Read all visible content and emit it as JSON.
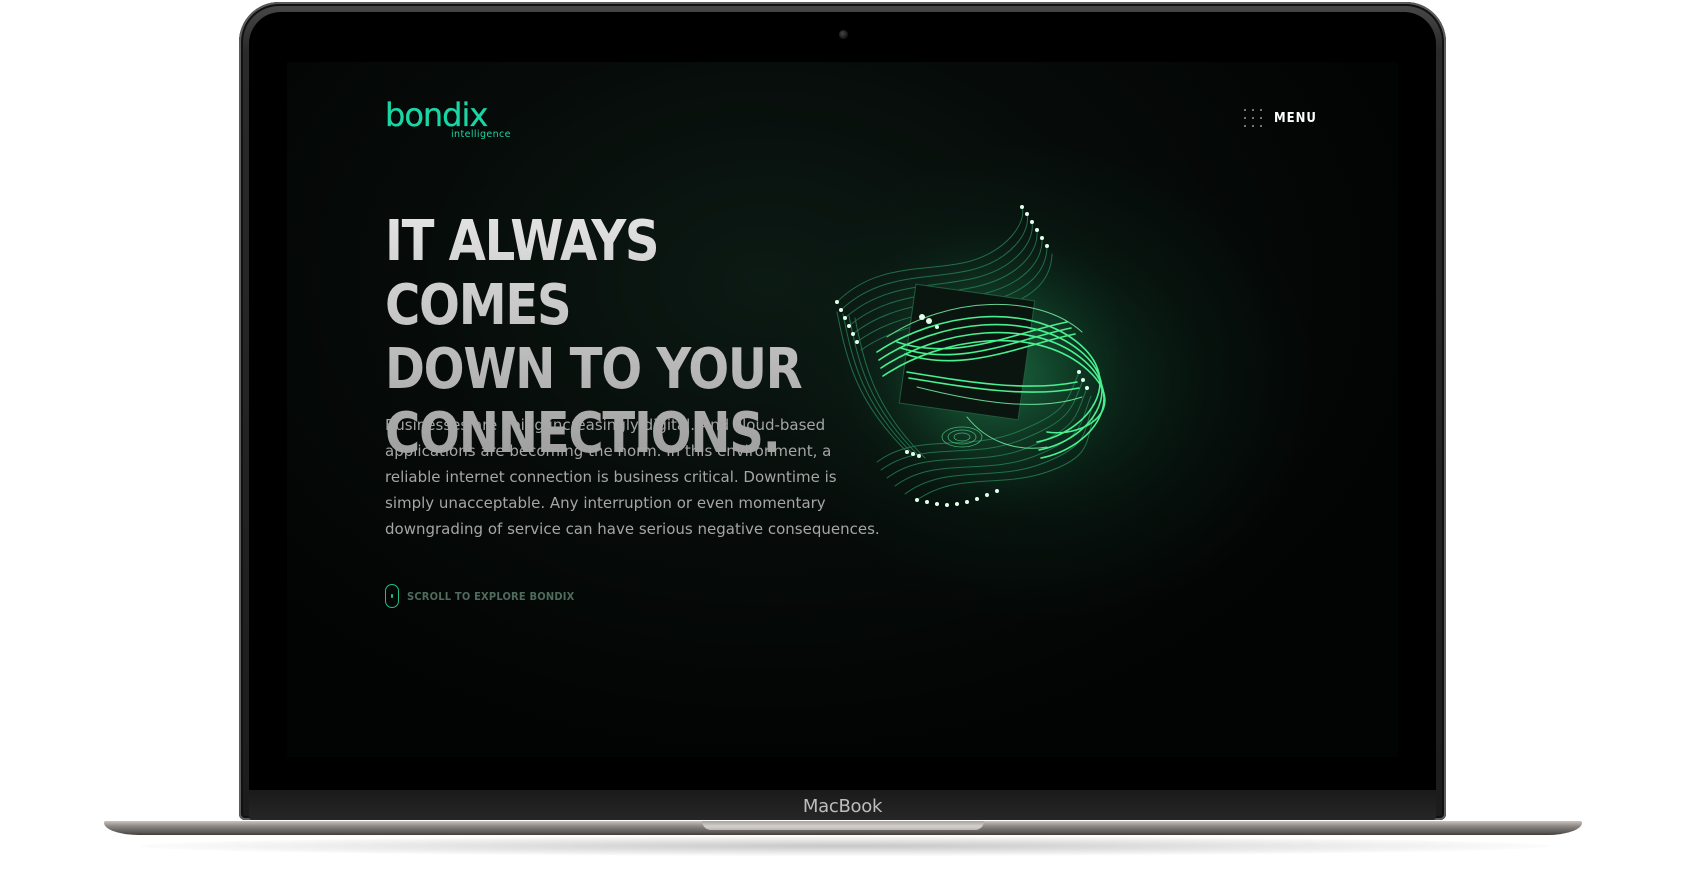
{
  "device": {
    "brand_label": "MacBook"
  },
  "site": {
    "logo": {
      "word": "bondix",
      "tagline": "intelligence"
    },
    "menu_label": "MENU",
    "hero": {
      "headline_lines": [
        "IT ALWAYS COMES",
        "DOWN TO YOUR",
        "CONNECTIONS."
      ],
      "body": "Businesses are going increasingly digital. And cloud-based applications are becoming the norm. In this environment, a reliable internet connection is business critical. Downtime is simply unacceptable. Any interruption or even momentary downgrading of service can have serious negative consequences.",
      "scroll_cta": "SCROLL TO EXPLORE BONDIX"
    }
  },
  "colors": {
    "brand": "#19d6a4",
    "accent_glow": "#2ee07d",
    "background": "#000000",
    "headline": "#cfcfcf",
    "body": "#a5a5a5"
  },
  "icons": {
    "menu": "dot-grid-icon",
    "scroll": "mouse-icon",
    "art": "connection-strands-illustration"
  }
}
